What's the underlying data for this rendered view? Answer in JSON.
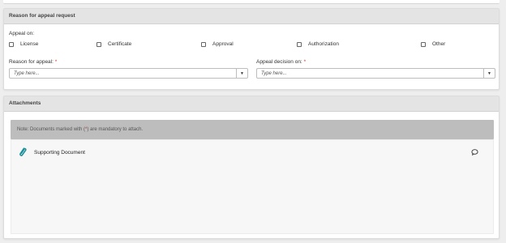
{
  "reason_section": {
    "title": "Reason for appeal request",
    "appeal_on_label": "Appeal on:",
    "options": [
      {
        "label": "License",
        "checked": false
      },
      {
        "label": "Certificate",
        "checked": false
      },
      {
        "label": "Approval",
        "checked": false
      },
      {
        "label": "Authorization",
        "checked": false
      },
      {
        "label": "Other",
        "checked": false
      }
    ],
    "reason_field": {
      "label": "Reason for appeal:",
      "required_mark": "*",
      "placeholder": "Type here..."
    },
    "decision_field": {
      "label": "Appeal decision on:",
      "required_mark": "*",
      "placeholder": "Type here..."
    },
    "dropdown_icon": "triangle-down"
  },
  "attachments_section": {
    "title": "Attachments",
    "note_prefix": "Note: Documents marked with (",
    "note_mark": "*",
    "note_suffix": ") are mandatory to attach.",
    "documents": [
      {
        "name": "Supporting Document",
        "icon": "paperclip",
        "action_icon": "comment"
      }
    ],
    "accent_color": "#1a8f9a"
  }
}
